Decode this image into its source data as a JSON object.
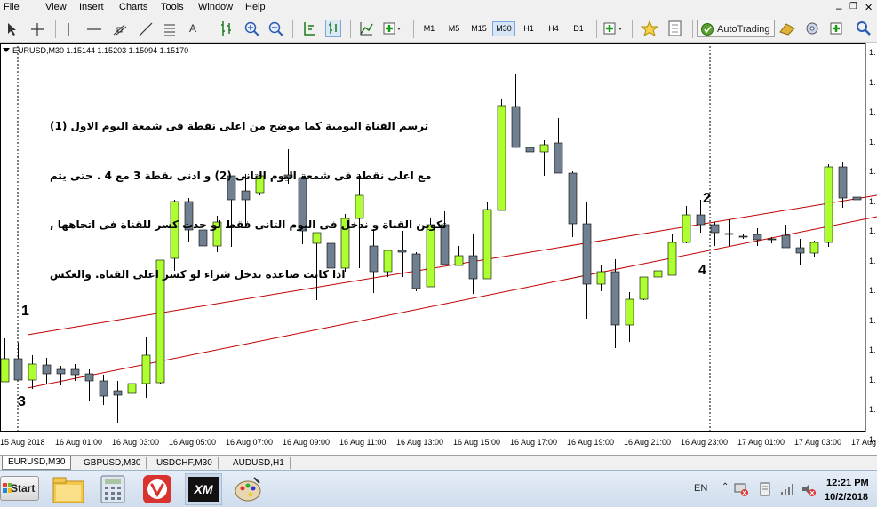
{
  "menubar": {
    "items": [
      "File",
      "View",
      "Insert",
      "Charts",
      "Tools",
      "Window",
      "Help"
    ]
  },
  "toolbar": {
    "timeframes": [
      "M1",
      "M5",
      "M15",
      "M30",
      "H1",
      "H4",
      "D1"
    ],
    "selected_timeframe": "M30",
    "autotrading_label": "AutoTrading"
  },
  "chart": {
    "header": "EURUSD,M30  1.15144 1.15203 1.15094 1.15170",
    "annotation_lines": [
      "ترسم القناة اليومية كما موضح من اعلى نقطة فى شمعة اليوم الاول (1)",
      "مع اعلى نقطة فى شمعة اليوم التانى (2) و ادنى نقطة 3 مع 4 . حتى يتم",
      "تكوين القناة و ندخل فى اليوم التانى فقط لو حدث كسر للقناة فى اتجاهها ,",
      "اذا كانت صاعدة ندخل شراء لو كسر اعلى القناة. والعكس"
    ],
    "point_labels": [
      "1",
      "3",
      "2",
      "4"
    ],
    "x_axis_labels": [
      "15 Aug 2018",
      "16 Aug 01:00",
      "16 Aug 03:00",
      "16 Aug 05:00",
      "16 Aug 07:00",
      "16 Aug 09:00",
      "16 Aug 11:00",
      "16 Aug 13:00",
      "16 Aug 15:00",
      "16 Aug 17:00",
      "16 Aug 19:00",
      "16 Aug 21:00",
      "16 Aug 23:00",
      "17 Aug 01:00",
      "17 Aug 03:00",
      "17 Aug"
    ],
    "y_axis_labels": [
      "1.",
      "1.",
      "1.",
      "1.",
      "1.",
      "1.",
      "1.",
      "1.",
      "1.",
      "1.",
      "1.",
      "1.",
      "1.",
      "1."
    ],
    "colors": {
      "bull": "#adff2f",
      "bear": "#708090",
      "channel": "#c00000"
    }
  },
  "tabs": {
    "items": [
      "EURUSD,M30",
      "GBPUSD,M30",
      "USDCHF,M30",
      "AUDUSD,H1"
    ],
    "active": "EURUSD,M30"
  },
  "taskbar": {
    "start_label": "Start",
    "language": "EN",
    "time": "12:21 PM",
    "date": "10/2/2018"
  }
}
